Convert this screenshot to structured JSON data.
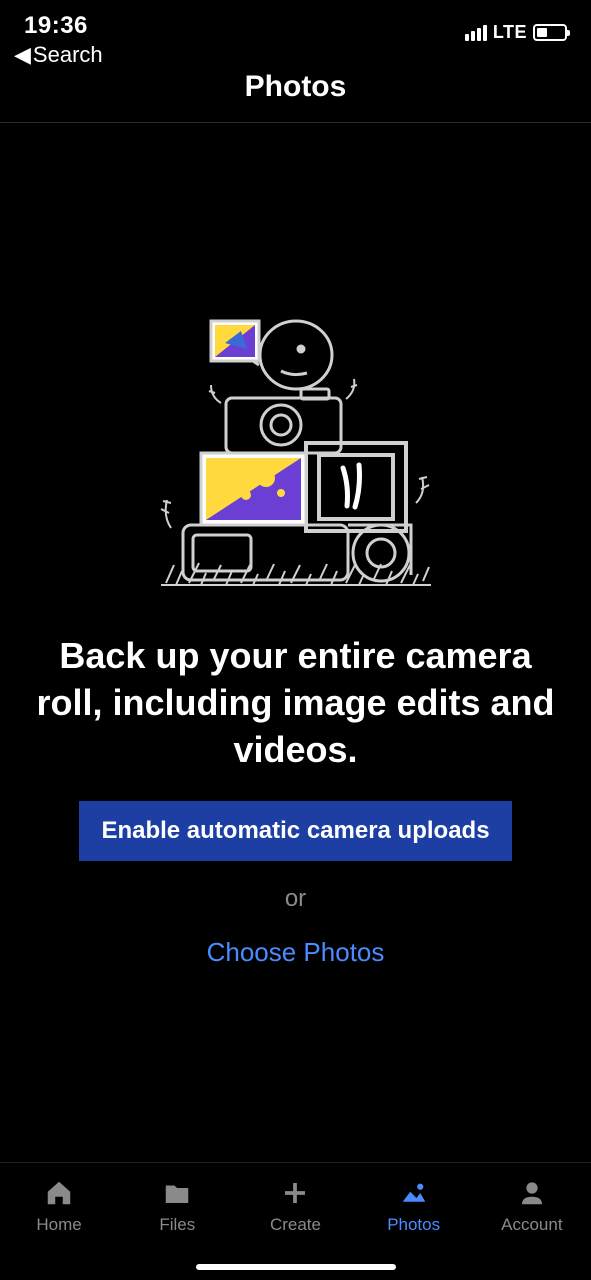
{
  "status": {
    "time": "19:36",
    "back_label": "Search",
    "network": "LTE"
  },
  "header": {
    "title": "Photos"
  },
  "main": {
    "promo": "Back up your entire camera roll, including image edits and videos.",
    "primary_button": "Enable automatic camera uploads",
    "or": "or",
    "secondary_link": "Choose Photos"
  },
  "tabs": {
    "home": "Home",
    "files": "Files",
    "create": "Create",
    "photos": "Photos",
    "account": "Account"
  }
}
